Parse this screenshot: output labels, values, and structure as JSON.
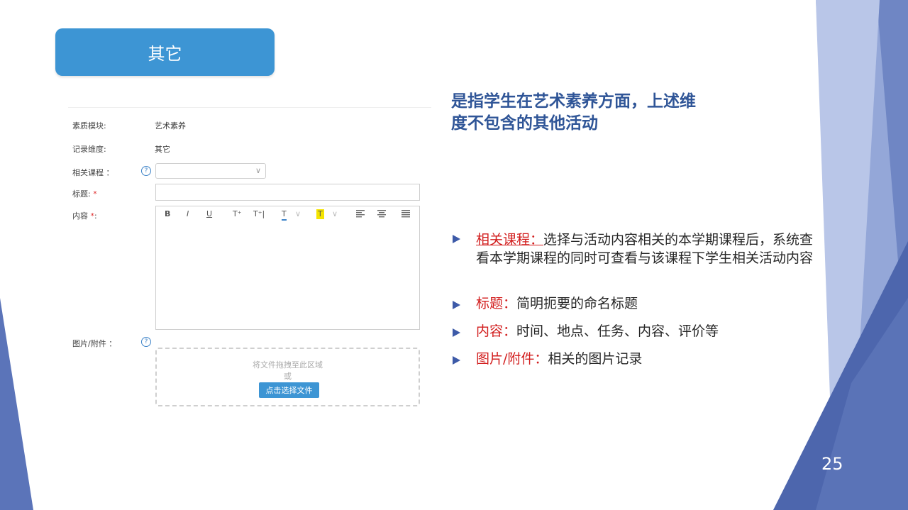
{
  "header": {
    "title": "其它"
  },
  "form": {
    "module_label": "素质模块:",
    "module_value": "艺术素养",
    "dimension_label": "记录维度:",
    "dimension_value": "其它",
    "course_label": "相关课程 ：",
    "title_label": "标题:",
    "content_label": "内容",
    "required_mark": "*",
    "content_colon": ":",
    "attachment_label": "图片/附件 ：",
    "help_glyph": "?",
    "toolbar": {
      "bold": "B",
      "italic": "I",
      "underline": "U",
      "superscript": "T⁺",
      "subscript": "T⁺|",
      "font_color": "T",
      "highlight": "T",
      "chevron": "∨"
    },
    "dropzone_hint": "将文件拖拽至此区域",
    "dropzone_or": "或",
    "dropzone_button": "点击选择文件"
  },
  "description": {
    "heading_line1": "是指学生在艺术素养方面，上述维",
    "heading_line2": "度不包含的其他活动",
    "bullets": [
      {
        "key": "相关课程：",
        "text": "选择与活动内容相关的本学期课程后，系统查看本学期课程的同时可查看与该课程下学生相关活动内容"
      },
      {
        "key": "标题：",
        "text": "简明扼要的命名标题"
      },
      {
        "key": "内容：",
        "text": "时间、地点、任务、内容、评价等"
      },
      {
        "key": "图片/附件：",
        "text": "相关的图片记录"
      }
    ]
  },
  "page_number": "25",
  "colors": {
    "accent": "#3d95d4",
    "heading": "#2f5597",
    "key_red": "#d21e1e",
    "deco_dark": "#5470b6",
    "deco_light": "#8fa3d6"
  }
}
